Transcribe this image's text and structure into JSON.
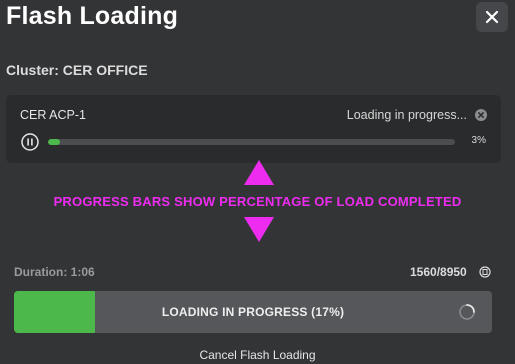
{
  "dialog": {
    "title": "Flash Loading",
    "close_icon": "close-icon",
    "cluster_label": "Cluster: CER OFFICE"
  },
  "device": {
    "name": "CER ACP-1",
    "status": "Loading in progress...",
    "status_icon": "cancel-circle-icon",
    "pause_icon": "pause-circle-icon",
    "progress_percent": 3,
    "progress_text": "3%"
  },
  "annotation": {
    "text": "PROGRESS BARS SHOW PERCENTAGE OF LOAD COMPLETED",
    "color": "#ee2cf0"
  },
  "overall": {
    "duration": "Duration: 1:06",
    "count": "1560/8950",
    "count_icon": "info-circle-icon",
    "progress_percent": 17,
    "label": "LOADING IN PROGRESS (17%)",
    "spinner_icon": "spinner-icon",
    "cancel_label": "Cancel Flash Loading"
  },
  "colors": {
    "background": "#333436",
    "card": "#2a2b2d",
    "progress_fill": "#4cb84c",
    "track": "#4b4d50"
  }
}
